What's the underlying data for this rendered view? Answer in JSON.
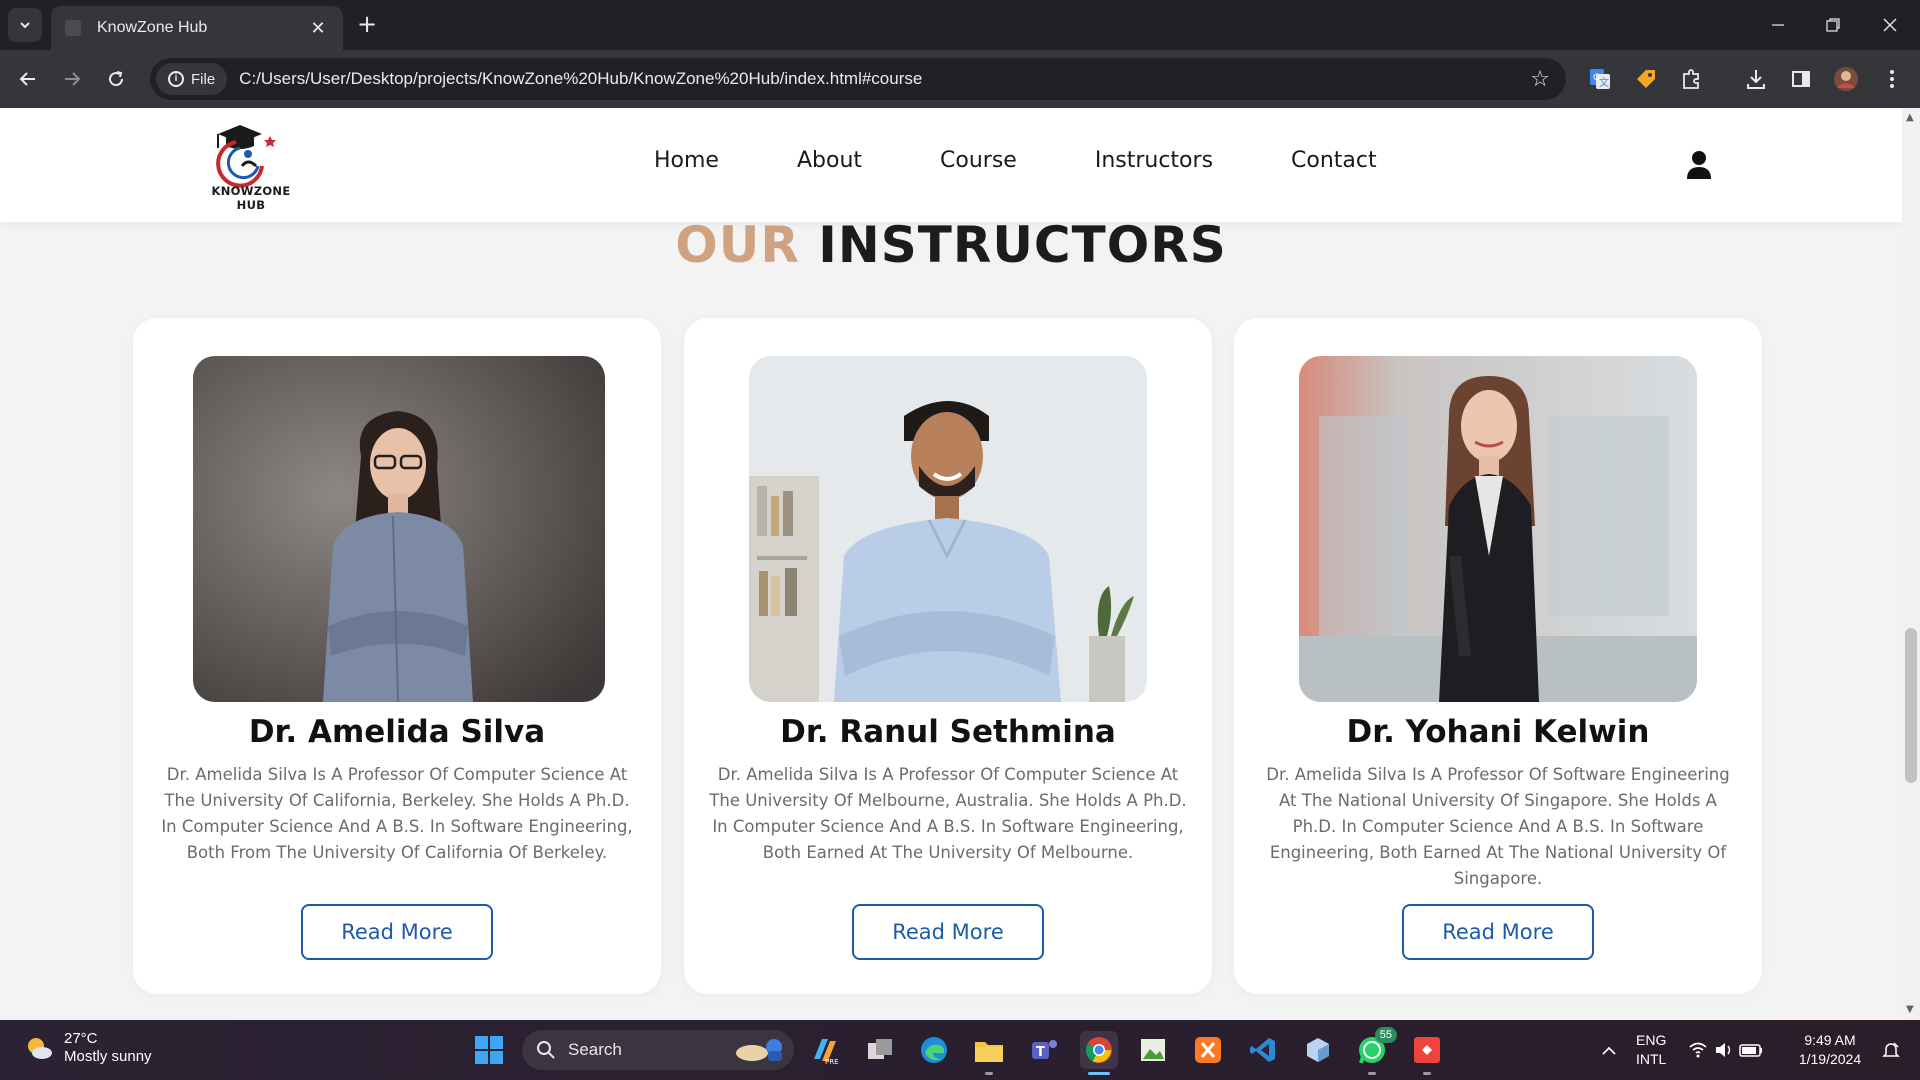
{
  "browser": {
    "tab_title": "KnowZone Hub",
    "site_chip": "File",
    "url": "C:/Users/User/Desktop/projects/KnowZone%20Hub/KnowZone%20Hub/index.html#course"
  },
  "header": {
    "logo_text": "KNOWZONE HUB",
    "nav": [
      "Home",
      "About",
      "Course",
      "Instructors",
      "Contact"
    ]
  },
  "section": {
    "title_accent": "OUR",
    "title_main": "INSTRUCTORS"
  },
  "instructors": [
    {
      "name": "Dr. Amelida Silva",
      "bio": "Dr. Amelida Silva Is A Professor Of Computer Science At The University Of California, Berkeley. She Holds A Ph.D. In Computer Science And A B.S. In Software Engineering, Both From The University Of California Of Berkeley.",
      "button": "Read More"
    },
    {
      "name": "Dr. Ranul Sethmina",
      "bio": "Dr. Amelida Silva Is A Professor Of Computer Science At The University Of Melbourne, Australia. She Holds A Ph.D. In Computer Science And A B.S. In Software Engineering, Both Earned At The University Of Melbourne.",
      "button": "Read More"
    },
    {
      "name": "Dr. Yohani Kelwin",
      "bio": "Dr. Amelida Silva Is A Professor Of Software Engineering At The National University Of Singapore. She Holds A Ph.D. In Computer Science And A B.S. In Software Engineering, Both Earned At The National University Of Singapore.",
      "button": "Read More"
    }
  ],
  "taskbar": {
    "weather_temp": "27°C",
    "weather_desc": "Mostly sunny",
    "search_label": "Search",
    "whatsapp_badge": "55",
    "lang_1": "ENG",
    "lang_2": "INTL",
    "time": "9:49 AM",
    "date": "1/19/2024"
  },
  "colors": {
    "accent": "#cfa382",
    "button_blue": "#1e5aa8",
    "chrome_dark": "#202124"
  }
}
